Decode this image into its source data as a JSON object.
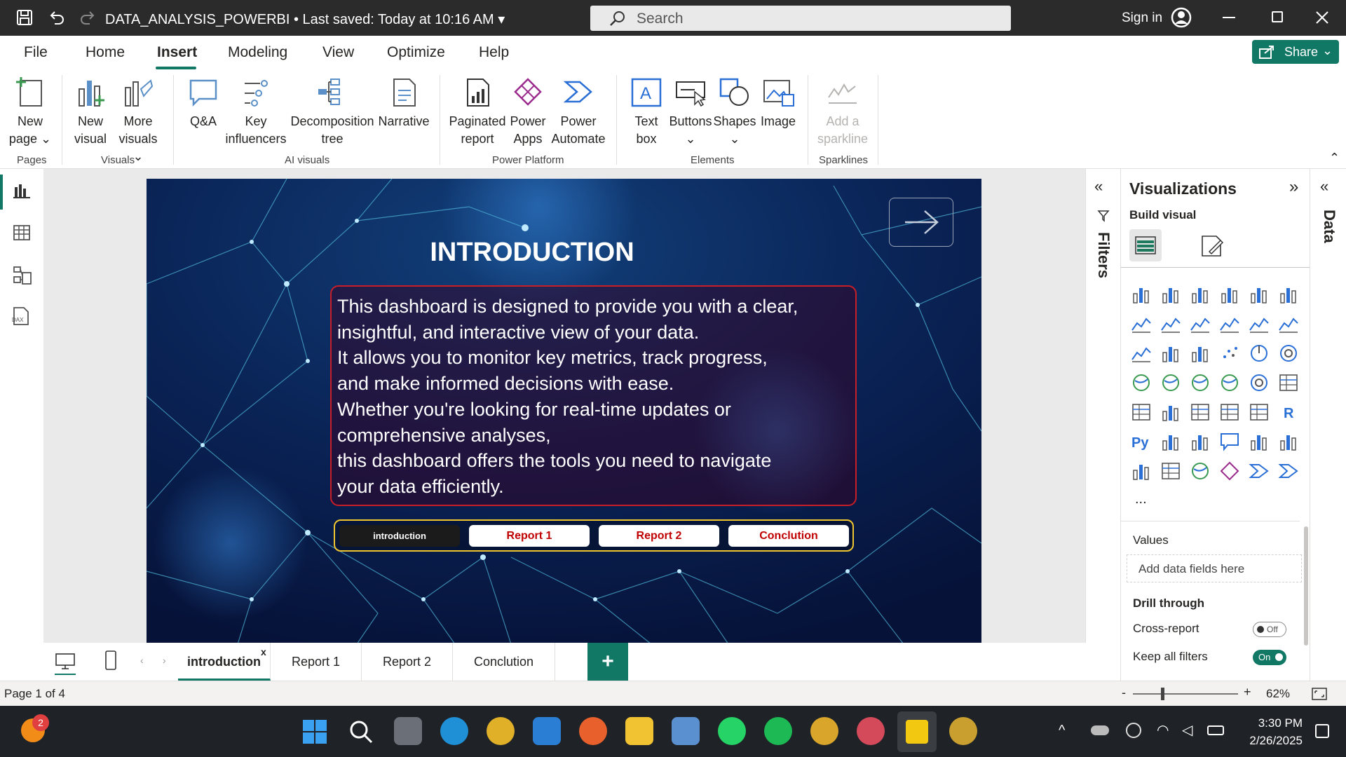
{
  "app": {
    "title": "DATA_ANALYSIS_POWERBI • Last saved: Today at 10:16 AM",
    "search_placeholder": "Search",
    "sign_in": "Sign in",
    "share": "Share"
  },
  "menu": [
    "File",
    "Home",
    "Insert",
    "Modeling",
    "View",
    "Optimize",
    "Help"
  ],
  "ribbon": {
    "new_page": [
      "New",
      "page"
    ],
    "new_visual": [
      "New",
      "visual"
    ],
    "more_visuals": [
      "More",
      "visuals"
    ],
    "qa": "Q&A",
    "key_influencers": [
      "Key",
      "influencers"
    ],
    "decomposition_tree": [
      "Decomposition",
      "tree"
    ],
    "narrative": "Narrative",
    "paginated_report": [
      "Paginated",
      "report"
    ],
    "power_apps": [
      "Power",
      "Apps"
    ],
    "power_automate": [
      "Power",
      "Automate"
    ],
    "text_box": [
      "Text",
      "box"
    ],
    "buttons": "Buttons",
    "shapes": "Shapes",
    "image": "Image",
    "add_sparkline": [
      "Add a",
      "sparkline"
    ],
    "groups": [
      "Pages",
      "Visuals",
      "AI visuals",
      "Power Platform",
      "Elements",
      "Sparklines"
    ]
  },
  "slide": {
    "title": "INTRODUCTION",
    "lines": [
      "This dashboard is designed to provide you with a clear,",
      "insightful, and interactive view of your data.",
      "It allows you to monitor key metrics, track progress,",
      "and make informed decisions with ease.",
      "Whether you're looking for real-time updates or",
      "comprehensive analyses,",
      "this dashboard offers the tools you need to navigate",
      "your data efficiently."
    ],
    "nav_buttons": [
      "introduction",
      "Report 1",
      "Report 2",
      "Conclution"
    ]
  },
  "filters": {
    "label": "Filters"
  },
  "visualizations": {
    "title": "Visualizations",
    "build_visual": "Build visual",
    "more": "...",
    "values_label": "Values",
    "values_placeholder": "Add data fields here",
    "drill_through": "Drill through",
    "cross_report": "Cross-report",
    "cross_report_state": "Off",
    "keep_filters": "Keep all filters",
    "keep_filters_state": "On"
  },
  "data_pane": {
    "label": "Data"
  },
  "page_tabs": [
    "introduction",
    "Report 1",
    "Report 2",
    "Conclution"
  ],
  "status": {
    "page": "Page 1 of 4",
    "zoom": "62%"
  },
  "taskbar": {
    "time": "3:30 PM",
    "date": "2/26/2025",
    "badge": "2"
  },
  "colors": {
    "accent": "#117865",
    "slide_bg": "#0b1b4a",
    "box_border": "#c81e28",
    "nav_border": "#f0c630"
  }
}
